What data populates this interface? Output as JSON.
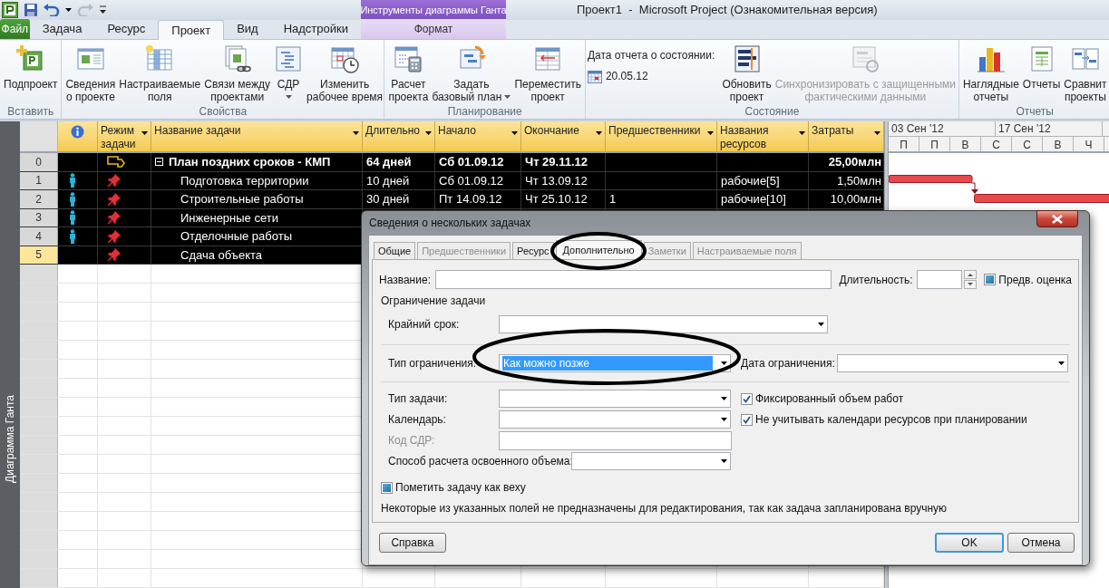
{
  "window": {
    "title": "Проект1  -  Microsoft Project (Ознакомительная версия)"
  },
  "contextual_tab_group": {
    "title": "Инструменты диаграммы Ганта"
  },
  "tabs": [
    {
      "label": "Файл",
      "kind": "file",
      "selected": false
    },
    {
      "label": "Задача",
      "kind": "normal",
      "selected": false
    },
    {
      "label": "Ресурс",
      "kind": "normal",
      "selected": false
    },
    {
      "label": "Проект",
      "kind": "normal",
      "selected": true
    },
    {
      "label": "Вид",
      "kind": "normal",
      "selected": false
    },
    {
      "label": "Надстройки",
      "kind": "normal",
      "selected": false
    },
    {
      "label": "Формат",
      "kind": "contextual",
      "selected": false
    }
  ],
  "ribbon": {
    "groups": [
      {
        "label": "Вставить",
        "buttons": [
          {
            "lines": [
              "Подпроект"
            ],
            "dropdown": false,
            "disabled": false
          }
        ]
      },
      {
        "label": "Свойства",
        "buttons": [
          {
            "lines": [
              "Сведения",
              "о проекте"
            ],
            "dropdown": false,
            "disabled": false
          },
          {
            "lines": [
              "Настраиваемые",
              "поля"
            ],
            "dropdown": false,
            "disabled": false
          },
          {
            "lines": [
              "Связи между",
              "проектами"
            ],
            "dropdown": false,
            "disabled": false
          },
          {
            "lines": [
              "СДР"
            ],
            "dropdown": true,
            "disabled": false
          },
          {
            "lines": [
              "Изменить",
              "рабочее время"
            ],
            "dropdown": false,
            "disabled": false
          }
        ]
      },
      {
        "label": "Планирование",
        "buttons": [
          {
            "lines": [
              "Расчет",
              "проекта"
            ],
            "dropdown": false,
            "disabled": false
          },
          {
            "lines": [
              "Задать",
              "базовый план"
            ],
            "dropdown": true,
            "disabled": false
          },
          {
            "lines": [
              "Переместить",
              "проект"
            ],
            "dropdown": false,
            "disabled": false
          }
        ]
      },
      {
        "label": "Состояние",
        "status_date": {
          "label": "Дата отчета о состоянии:",
          "value": "20.05.12"
        },
        "buttons": [
          {
            "lines": [
              "Обновить",
              "проект"
            ],
            "dropdown": false,
            "disabled": false
          },
          {
            "lines": [
              "Синхронизировать с защищенными",
              "фактическими данными"
            ],
            "dropdown": false,
            "disabled": true
          }
        ]
      },
      {
        "label": "Отчеты",
        "buttons": [
          {
            "lines": [
              "Наглядные",
              "отчеты"
            ],
            "dropdown": false,
            "disabled": false
          },
          {
            "lines": [
              "Отчеты"
            ],
            "dropdown": false,
            "disabled": false
          },
          {
            "lines": [
              "Сравнит",
              "проекты"
            ],
            "dropdown": false,
            "disabled": false
          }
        ]
      }
    ]
  },
  "view_bar": {
    "label": "Диаграмма Ганта"
  },
  "table": {
    "columns": [
      {
        "kind": "id"
      },
      {
        "kind": "info"
      },
      {
        "kind": "field",
        "label": "Режим задачи"
      },
      {
        "kind": "field",
        "label": "Название задачи"
      },
      {
        "kind": "field",
        "label": "Длительно"
      },
      {
        "kind": "field",
        "label": "Начало"
      },
      {
        "kind": "field",
        "label": "Окончание"
      },
      {
        "kind": "field",
        "label": "Предшественники"
      },
      {
        "kind": "field",
        "label": "Названия ресурсов"
      },
      {
        "kind": "field",
        "label": "Затраты"
      }
    ],
    "rows": [
      {
        "id": "0",
        "indicator": false,
        "kind": "summary",
        "expanded": true,
        "name": "План поздних сроков - КМП",
        "duration": "64 дней",
        "start": "Сб 01.09.12",
        "finish": "Чт 29.11.12",
        "cost": "25,00млн",
        "selected": false
      },
      {
        "id": "1",
        "indicator": true,
        "kind": "task",
        "name": "Подготовка территории",
        "duration": "10 дней",
        "start": "Сб 01.09.12",
        "finish": "Чт 13.09.12",
        "resources": "рабочие[5]",
        "cost": "1,50млн",
        "selected": false
      },
      {
        "id": "2",
        "indicator": true,
        "kind": "task",
        "name": "Строительные работы",
        "duration": "30 дней",
        "start": "Пт 14.09.12",
        "finish": "Чт 25.10.12",
        "predecessors": "1",
        "resources": "рабочие[10]",
        "cost": "10,00млн",
        "selected": false
      },
      {
        "id": "3",
        "indicator": true,
        "kind": "task",
        "name": "Инженерные сети",
        "selected": false
      },
      {
        "id": "4",
        "indicator": true,
        "kind": "task",
        "name": "Отделочные работы",
        "selected": false
      },
      {
        "id": "5",
        "indicator": false,
        "kind": "task",
        "name": "Сдача объекта",
        "selected": true
      }
    ]
  },
  "gantt": {
    "weeks": [
      "03 Сен '12",
      "17 Сен '12"
    ],
    "days": [
      "П",
      "П",
      "В",
      "С",
      "С",
      "В",
      "Ч"
    ]
  },
  "dialog": {
    "title": "Сведения о нескольких задачах",
    "tabs": [
      {
        "label": "Общие",
        "disabled": false,
        "selected": false
      },
      {
        "label": "Предшественники",
        "disabled": true,
        "selected": false
      },
      {
        "label": "Ресурс",
        "disabled": false,
        "selected": false
      },
      {
        "label": "Дополнительно",
        "disabled": false,
        "selected": true
      },
      {
        "label": "Заметки",
        "disabled": true,
        "selected": false
      },
      {
        "label": "Настраиваемые поля",
        "disabled": true,
        "selected": false
      }
    ],
    "name_field": {
      "label": "Название:"
    },
    "duration_field": {
      "label": "Длительность:"
    },
    "estimated": {
      "label": "Предв. оценка",
      "checked": false,
      "indeterminate": true
    },
    "constraint_group": {
      "title": "Ограничение задачи",
      "deadline": {
        "label": "Крайний срок:"
      },
      "constraint_type": {
        "label": "Тип ограничения:",
        "value": "Как можно позже",
        "highlighted": true
      },
      "constraint_date": {
        "label": "Дата ограничения:"
      }
    },
    "task_type": {
      "label": "Тип задачи:"
    },
    "effort_driven": {
      "label": "Фиксированный объем работ",
      "checked": true
    },
    "calendar": {
      "label": "Календарь:"
    },
    "ignore_calendars": {
      "label": "Не учитывать календари ресурсов при планировании",
      "checked": true
    },
    "wbs_code": {
      "label": "Код СДР:",
      "disabled": true
    },
    "earned_value": {
      "label": "Способ расчета освоенного объема:"
    },
    "milestone": {
      "label": "Пометить задачу как веху",
      "checked": false,
      "indeterminate": true
    },
    "note": "Некоторые из указанных полей не предназначены для редактирования, так как задача запланирована вручную",
    "buttons": [
      {
        "label": "Справка",
        "default": false
      },
      {
        "label": "OK",
        "default": true
      },
      {
        "label": "Отмена",
        "default": false
      }
    ]
  }
}
